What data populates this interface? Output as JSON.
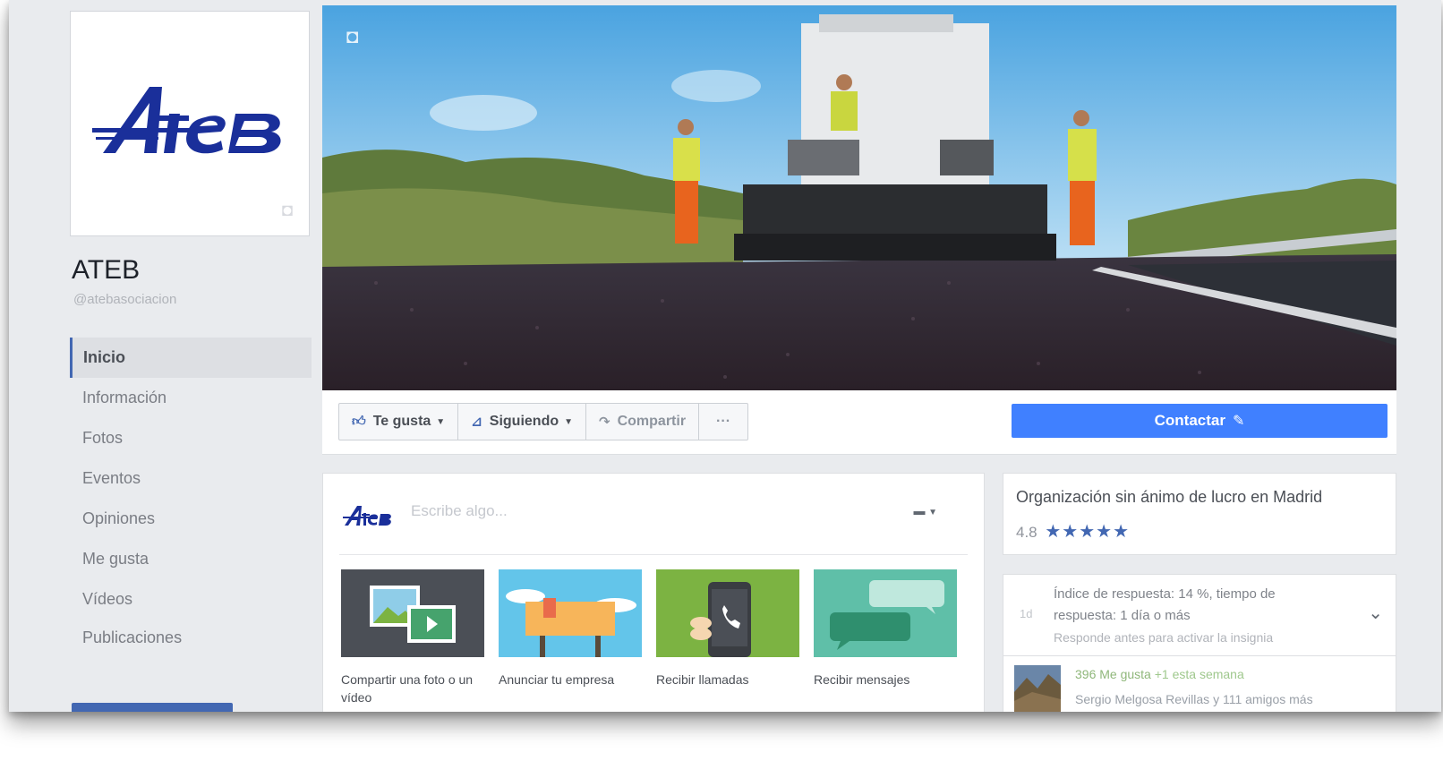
{
  "page": {
    "name": "ATEB",
    "handle": "@atebasociacion",
    "logo_text": "ATEB"
  },
  "nav": {
    "items": [
      {
        "label": "Inicio",
        "active": true
      },
      {
        "label": "Información"
      },
      {
        "label": "Fotos"
      },
      {
        "label": "Eventos"
      },
      {
        "label": "Opiniones"
      },
      {
        "label": "Me gusta"
      },
      {
        "label": "Vídeos"
      },
      {
        "label": "Publicaciones"
      }
    ]
  },
  "actions": {
    "like": "Te gusta",
    "follow": "Siguiendo",
    "share": "Compartir",
    "more": "···",
    "contact": "Contactar"
  },
  "composer": {
    "placeholder": "Escribe algo...",
    "tiles": [
      {
        "label": "Compartir una foto o un vídeo"
      },
      {
        "label": "Anunciar tu empresa"
      },
      {
        "label": "Recibir llamadas"
      },
      {
        "label": "Recibir mensajes"
      }
    ]
  },
  "about": {
    "category": "Organización sin ánimo de lucro en Madrid",
    "rating": "4.8",
    "stars": "★★★★★",
    "rating_value": 4.8
  },
  "response": {
    "text": "Índice de respuesta: 14 %, tiempo de respuesta: 1 día o más",
    "hint": "Responde antes para activar la insignia",
    "icon_text": "1d"
  },
  "likes": {
    "count_text": "396 Me gusta",
    "week_text": "+1 esta semana",
    "friends_text": "Sergio Melgosa Revillas y 111 amigos más"
  },
  "colors": {
    "brand_blue": "#4267b2",
    "contact_blue": "#4080ff",
    "page_bg": "#e9ebee",
    "logo_blue": "#1a2f9a"
  }
}
